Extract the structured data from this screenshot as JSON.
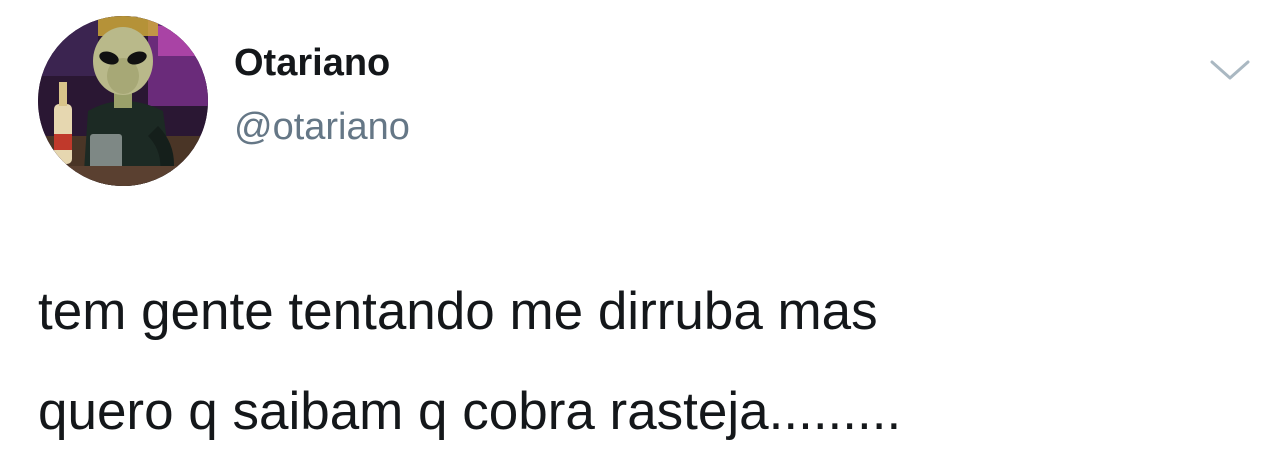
{
  "tweet": {
    "author": {
      "display_name": "Otariano",
      "handle": "@otariano",
      "avatar_icon": "alien-avatar-icon"
    },
    "menu_icon": "chevron-down-icon",
    "text_lines": [
      "tem gente tentando me dirruba mas",
      "quero q saibam q cobra rasteja........."
    ]
  },
  "colors": {
    "text_primary": "#14171a",
    "text_secondary": "#657786",
    "chevron": "#aab8c2",
    "background": "#ffffff"
  }
}
